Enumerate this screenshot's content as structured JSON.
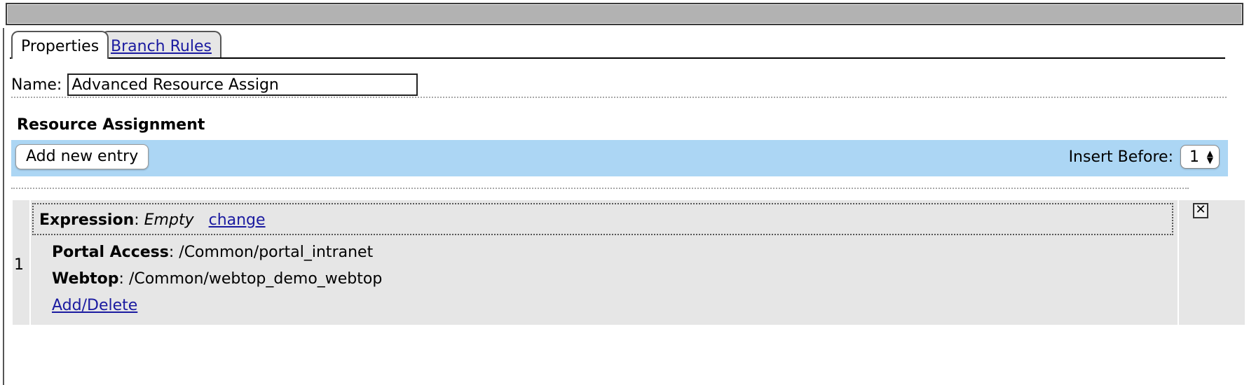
{
  "tabs": [
    {
      "label": "Properties",
      "active": true
    },
    {
      "label": "Branch Rules",
      "active": false
    }
  ],
  "name_field": {
    "label": "Name:",
    "value": "Advanced Resource Assign"
  },
  "section_title": "Resource Assignment",
  "toolbar": {
    "add_button": "Add new entry",
    "insert_before_label": "Insert Before:",
    "insert_before_value": "1",
    "background": "#acd6f4"
  },
  "entries": [
    {
      "index": "1",
      "expression_label": "Expression",
      "expression_value": "Empty",
      "change_link": "change",
      "portal_access_label": "Portal Access",
      "portal_access_value": "/Common/portal_intranet",
      "webtop_label": "Webtop",
      "webtop_value": "/Common/webtop_demo_webtop",
      "add_delete_link": "Add/Delete"
    }
  ],
  "icons": {
    "close": "close-icon",
    "select_arrows": "updown-arrows-icon"
  }
}
